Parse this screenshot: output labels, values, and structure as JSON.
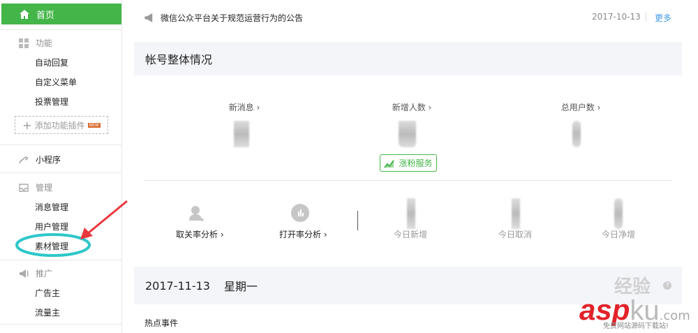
{
  "sidebar": {
    "home": "首页",
    "sections": [
      {
        "title": "功能",
        "items": [
          "自动回复",
          "自定义菜单",
          "投票管理"
        ],
        "add_plugin": "添加功能插件",
        "new_badge": "NEW"
      },
      {
        "title": "小程序"
      },
      {
        "title": "管理",
        "items": [
          "消息管理",
          "用户管理",
          "素材管理"
        ]
      },
      {
        "title": "推广",
        "items": [
          "广告主",
          "流量主"
        ]
      }
    ],
    "highlighted_item": "素材管理"
  },
  "notice": {
    "text": "微信公众平台关于规范运营行为的公告",
    "date": "2017-10-13",
    "more": "更多"
  },
  "account": {
    "title": "帐号整体情况",
    "stats": [
      {
        "label": "新消息 ›"
      },
      {
        "label": "新增人数 ›"
      },
      {
        "label": "总用户数 ›"
      }
    ],
    "grow_button": "涨粉服务",
    "analysis": [
      {
        "label": "取关率分析 ›"
      },
      {
        "label": "打开率分析 ›"
      }
    ],
    "today": [
      "今日新增",
      "今日取消",
      "今日净增"
    ]
  },
  "daily": {
    "date": "2017-11-13",
    "weekday": "星期一",
    "hot_events": "热点事件"
  },
  "watermark": {
    "brand": "asp",
    "brand2": "ku",
    ".com": ".com",
    "slogan": "免费网站源码下载站!",
    "jingyan": "经验"
  },
  "colors": {
    "accent": "#44b549",
    "link": "#459ae9",
    "annotation": "#2ec7c9",
    "arrow": "#e8383d"
  }
}
